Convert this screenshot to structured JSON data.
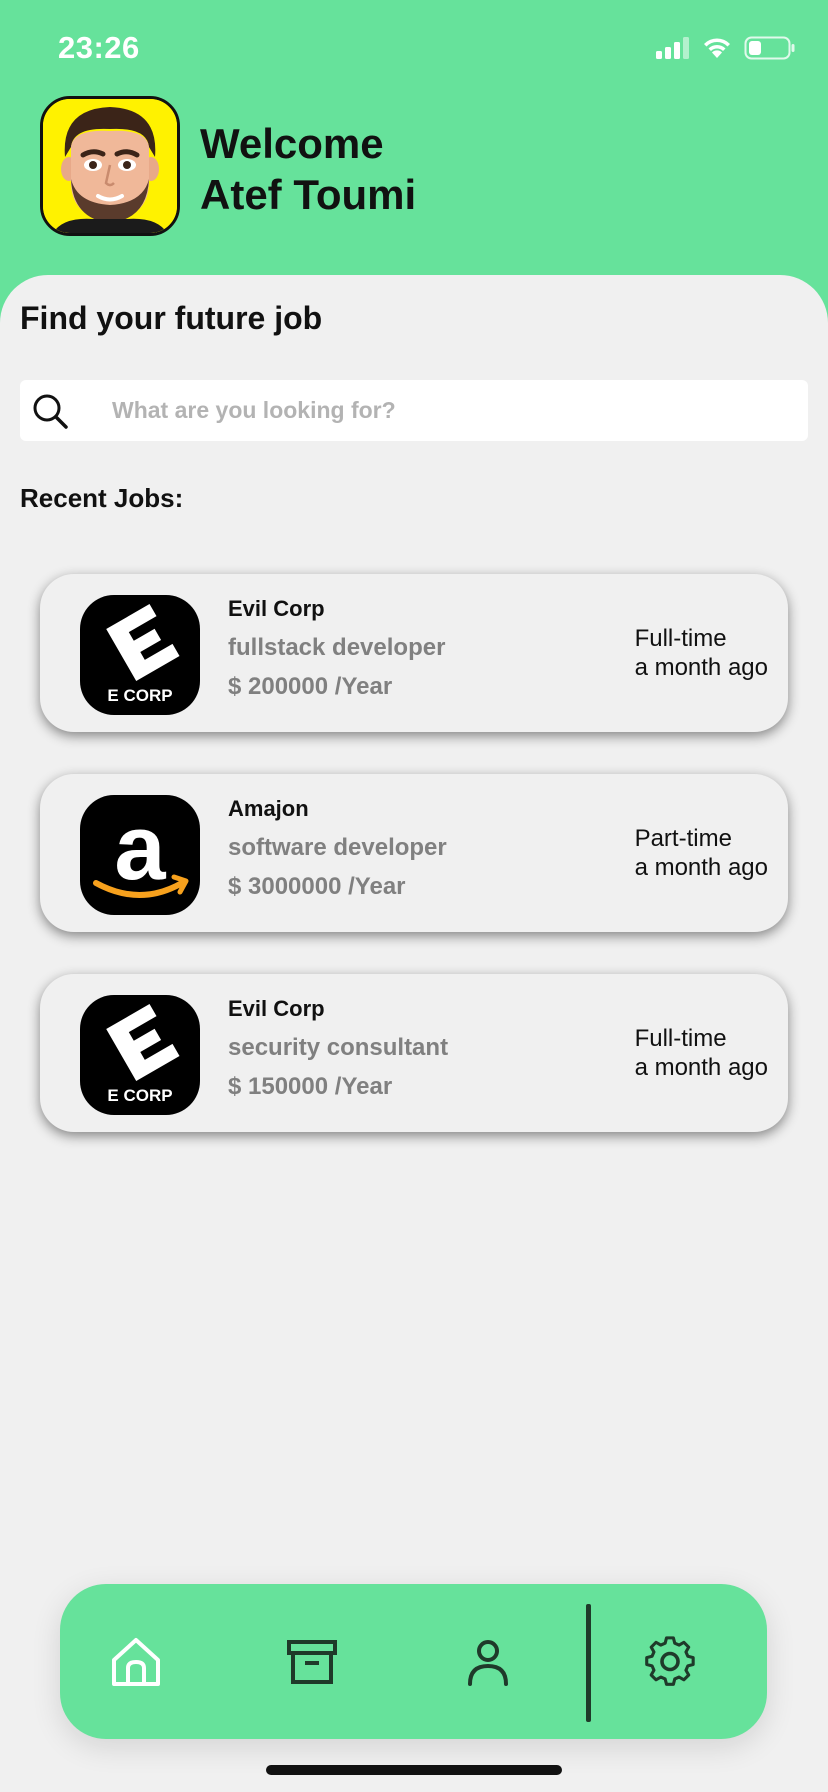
{
  "status_bar": {
    "time": "23:26"
  },
  "header": {
    "greeting": "Welcome",
    "user_name": "Atef Toumi"
  },
  "main": {
    "title": "Find your future job",
    "search": {
      "placeholder": "What are you looking for?",
      "value": ""
    },
    "recent_label": "Recent Jobs:",
    "jobs": [
      {
        "company": "Evil Corp",
        "role": "fullstack developer",
        "salary": "$ 200000 /Year",
        "type": "Full-time",
        "posted": "a month ago",
        "logo": "ecorp-logo",
        "logo_text": "E CORP"
      },
      {
        "company": "Amajon",
        "role": "software developer",
        "salary": "$ 3000000 /Year",
        "type": "Part-time",
        "posted": "a month ago",
        "logo": "amazon-logo",
        "logo_text": "a"
      },
      {
        "company": "Evil Corp",
        "role": "security consultant",
        "salary": "$ 150000 /Year",
        "type": "Full-time",
        "posted": "a month ago",
        "logo": "ecorp-logo",
        "logo_text": "E CORP"
      }
    ]
  },
  "bottom_nav": {
    "items": [
      "home-icon",
      "archive-icon",
      "profile-icon",
      "settings-icon"
    ],
    "active": "home-icon"
  },
  "colors": {
    "accent": "#66e29b",
    "background": "#f0f0f0",
    "muted_text": "#808080",
    "nav_icon": "#1f3a2a",
    "active_icon": "#ffffff"
  }
}
